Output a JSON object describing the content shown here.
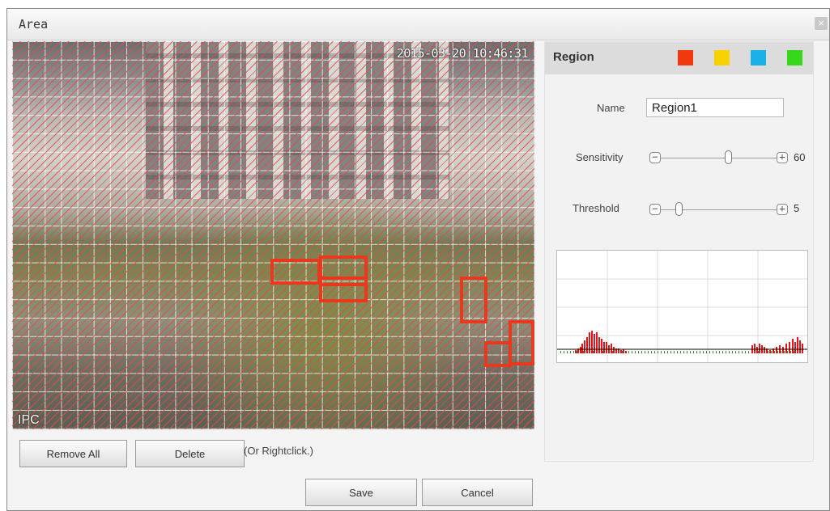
{
  "window": {
    "title": "Area",
    "close_glyph": "×"
  },
  "video": {
    "timestamp": "2015-03-20 10:46:31",
    "camera_label": "IPC"
  },
  "actions": {
    "remove_all": "Remove All",
    "delete": "Delete",
    "hint": "(Or Rightclick.)",
    "save": "Save",
    "cancel": "Cancel"
  },
  "panel": {
    "region_label": "Region",
    "region_colors": [
      "#f23a0f",
      "#f7d100",
      "#1ab1e6",
      "#37d81c"
    ],
    "name_label": "Name",
    "name_value": "Region1",
    "sensitivity_label": "Sensitivity",
    "sensitivity_value": "60",
    "threshold_label": "Threshold",
    "threshold_value": "5",
    "stepper_minus": "−",
    "stepper_plus": "+"
  },
  "colors": {
    "region_outline": "#e8381e",
    "motion_bar": "#e0161c",
    "baseline_bar": "#2e8b2e"
  }
}
